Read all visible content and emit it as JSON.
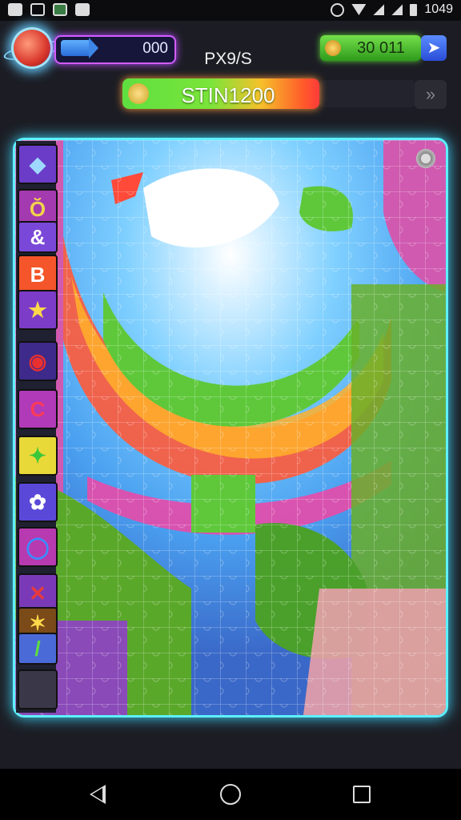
{
  "status_bar": {
    "time": "1049",
    "icons": [
      "photo-icon",
      "image-icon",
      "gallery-icon",
      "android-icon",
      "alarm-icon",
      "wifi-icon",
      "signal-icon",
      "signal-icon",
      "battery-icon"
    ]
  },
  "hud": {
    "score_value": "000",
    "title": "PX9/S",
    "coins_value": "30 011",
    "progress_label": "STIN1200",
    "icons": [
      "orb-avatar-icon",
      "arrow-icon",
      "coin-icon",
      "share-icon",
      "leaf-icon",
      "skip-icon",
      "settings-icon"
    ],
    "colors": {
      "accent_purple": "#d25cff",
      "accent_green": "#5ee040",
      "board_glow": "#5ef0ff"
    }
  },
  "tray": {
    "tiles": [
      {
        "name": "diamond-tile",
        "glyph": "◆",
        "bg": "#6a3cc8",
        "fg": "#9fd8ff"
      },
      {
        "name": "bow-tile",
        "glyph": "Ŏ",
        "bg": "#a43ab0",
        "fg": "#f2d34a"
      },
      {
        "name": "ampersand-tile",
        "glyph": "&",
        "bg": "#7a48d8",
        "fg": "#ffffff"
      },
      {
        "name": "b-tile",
        "glyph": "B",
        "bg": "#f4552a",
        "fg": "#ffffff"
      },
      {
        "name": "star-tile",
        "glyph": "★",
        "bg": "#7d3cc8",
        "fg": "#ffd84a"
      },
      {
        "name": "eye-tile",
        "glyph": "◉",
        "bg": "#3d2a8a",
        "fg": "#e83030"
      },
      {
        "name": "swirl-tile",
        "glyph": "C",
        "bg": "#b03ab8",
        "fg": "#ff3a5a"
      },
      {
        "name": "green-star-tile",
        "glyph": "✦",
        "bg": "#e8d838",
        "fg": "#3ac83a"
      },
      {
        "name": "gem-tile",
        "glyph": "✿",
        "bg": "#5a48d8",
        "fg": "#ffffff"
      },
      {
        "name": "ring-tile",
        "glyph": "◯",
        "bg": "#b83ab0",
        "fg": "#3a8cff"
      },
      {
        "name": "cross-tile",
        "glyph": "✕",
        "bg": "#7a3ab8",
        "fg": "#e83a3a"
      },
      {
        "name": "sparkle-tile",
        "glyph": "✶",
        "bg": "#7a4a18",
        "fg": "#ffd84a"
      },
      {
        "name": "check-tile",
        "glyph": "/",
        "bg": "#4a6ad8",
        "fg": "#5ee040"
      },
      {
        "name": "blank-tile",
        "glyph": "",
        "bg": "#3a3848",
        "fg": "#3a3848"
      }
    ]
  }
}
